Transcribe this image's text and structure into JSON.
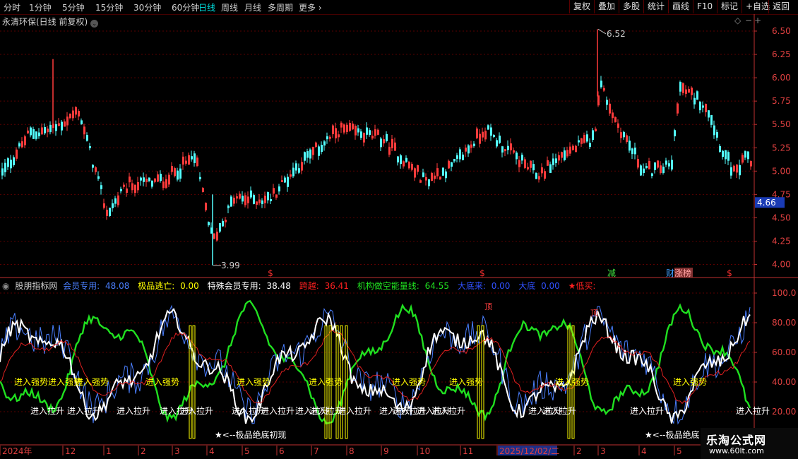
{
  "toolbar": {
    "timeframes": [
      "分时",
      "1分钟",
      "5分钟",
      "15分钟",
      "30分钟",
      "60分钟",
      "日线",
      "周线",
      "月线",
      "多周期",
      "更多"
    ],
    "active_timeframe": "日线",
    "right_buttons": [
      "复权",
      "叠加",
      "多股",
      "统计",
      "画线",
      "F10",
      "标记",
      "+自选",
      "返回"
    ]
  },
  "price_chart": {
    "title": "永清环保(日线 前复权)",
    "y_ticks": [
      "6.50",
      "6.25",
      "6.00",
      "5.75",
      "5.50",
      "5.25",
      "5.00",
      "4.75",
      "4.50",
      "4.25",
      "4.00"
    ],
    "y_values": [
      6.5,
      6.25,
      6.0,
      5.75,
      5.5,
      5.25,
      5.0,
      4.75,
      4.5,
      4.25,
      4.0
    ],
    "current_price": "4.66",
    "high_label": "6.52",
    "low_label": "3.99",
    "event_markers": [
      "$",
      "$",
      "减",
      "财",
      "涨榜",
      "$"
    ],
    "colors": {
      "up": "#ff3b3b",
      "down": "#54ffff",
      "grid": "#5a0000",
      "axis": "#c03030"
    }
  },
  "indicator": {
    "name": "股朋指标网",
    "values": [
      {
        "label": "会员专用:",
        "value": "48.08",
        "color": "#4a7fff"
      },
      {
        "label": "极品逃亡:",
        "value": "0.00",
        "color": "#ffff00"
      },
      {
        "label": "特殊会员专用:",
        "value": "38.48",
        "color": "#ffffff"
      },
      {
        "label": "跨越:",
        "value": "36.41",
        "color": "#ff2020"
      },
      {
        "label": "机构做空能量线:",
        "value": "64.55",
        "color": "#20e020"
      },
      {
        "label": "大底来:",
        "value": "0.00",
        "color": "#3050ff"
      },
      {
        "label": "大底",
        "value": "0.00",
        "color": "#3050ff"
      },
      {
        "label": "★低买:",
        "value": "",
        "color": "#ff2020"
      }
    ],
    "y_ticks": [
      "100.0",
      "80.00",
      "60.00",
      "40.00",
      "20.00"
    ],
    "y_values": [
      100,
      80,
      60,
      40,
      20
    ],
    "top_labels": [
      "顶",
      "顶"
    ],
    "yellow_labels": [
      "进入强势",
      "进入强势",
      "进入强势",
      "进入强势",
      "进入强势",
      "进入强势",
      "进入强势",
      "进入强势",
      "进入强势",
      "进入强势"
    ],
    "white_labels": [
      "进入拉升",
      "进入拉升",
      "进入拉升",
      "进入拉升",
      "进入拉升",
      "进入拉升",
      "进入拉升",
      "进入拉升",
      "进入拉升",
      "进入拉升",
      "进入拉升",
      "进入拉升",
      "进入拉升",
      "进入拉升",
      "进入拉升",
      "进入拉升",
      "进入拉升",
      "进入拉升"
    ],
    "bottom_notes": [
      "★<--极品绝底初现",
      "★<--极品绝底"
    ]
  },
  "time_axis": {
    "labels": [
      "2024年",
      "12",
      "1",
      "2",
      "3",
      "4",
      "5",
      "6",
      "7",
      "8",
      "9",
      "10",
      "11",
      "2025/12/02/二",
      "2",
      "3",
      "4",
      "5"
    ]
  },
  "watermark": {
    "title": "乐淘公式网",
    "url": "www.60lt.com"
  }
}
